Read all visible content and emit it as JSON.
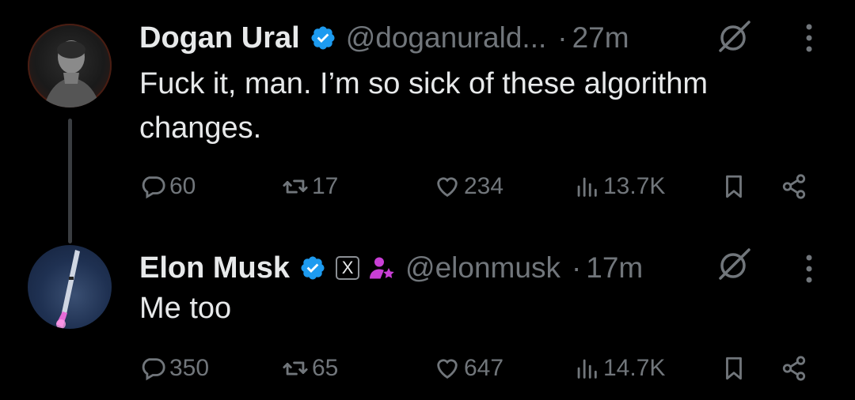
{
  "tweets": [
    {
      "author": {
        "name": "Dogan Ural",
        "handle": "@doganurald...",
        "verified": true
      },
      "time": "27m",
      "separator": "·",
      "text": "Fuck it, man. I’m so sick of these algorithm changes.",
      "stats": {
        "replies": "60",
        "reposts": "17",
        "likes": "234",
        "views": "13.7K"
      }
    },
    {
      "author": {
        "name": "Elon Musk",
        "handle": "@elonmusk",
        "verified": true,
        "affiliate_badge": "X"
      },
      "time": "17m",
      "separator": "·",
      "text": "Me too",
      "stats": {
        "replies": "350",
        "reposts": "65",
        "likes": "647",
        "views": "14.7K"
      }
    }
  ],
  "colors": {
    "background": "#000000",
    "text": "#e7e9ea",
    "muted": "#71767b",
    "verified": "#1d9bf0",
    "affiliate": "#c93fd6",
    "thread_line": "#3a3d41"
  },
  "icons": [
    "verified-badge-icon",
    "grok-icon",
    "more-icon",
    "reply-icon",
    "repost-icon",
    "like-icon",
    "views-icon",
    "bookmark-icon",
    "share-icon",
    "x-affiliate-icon",
    "affiliate-person-icon"
  ]
}
